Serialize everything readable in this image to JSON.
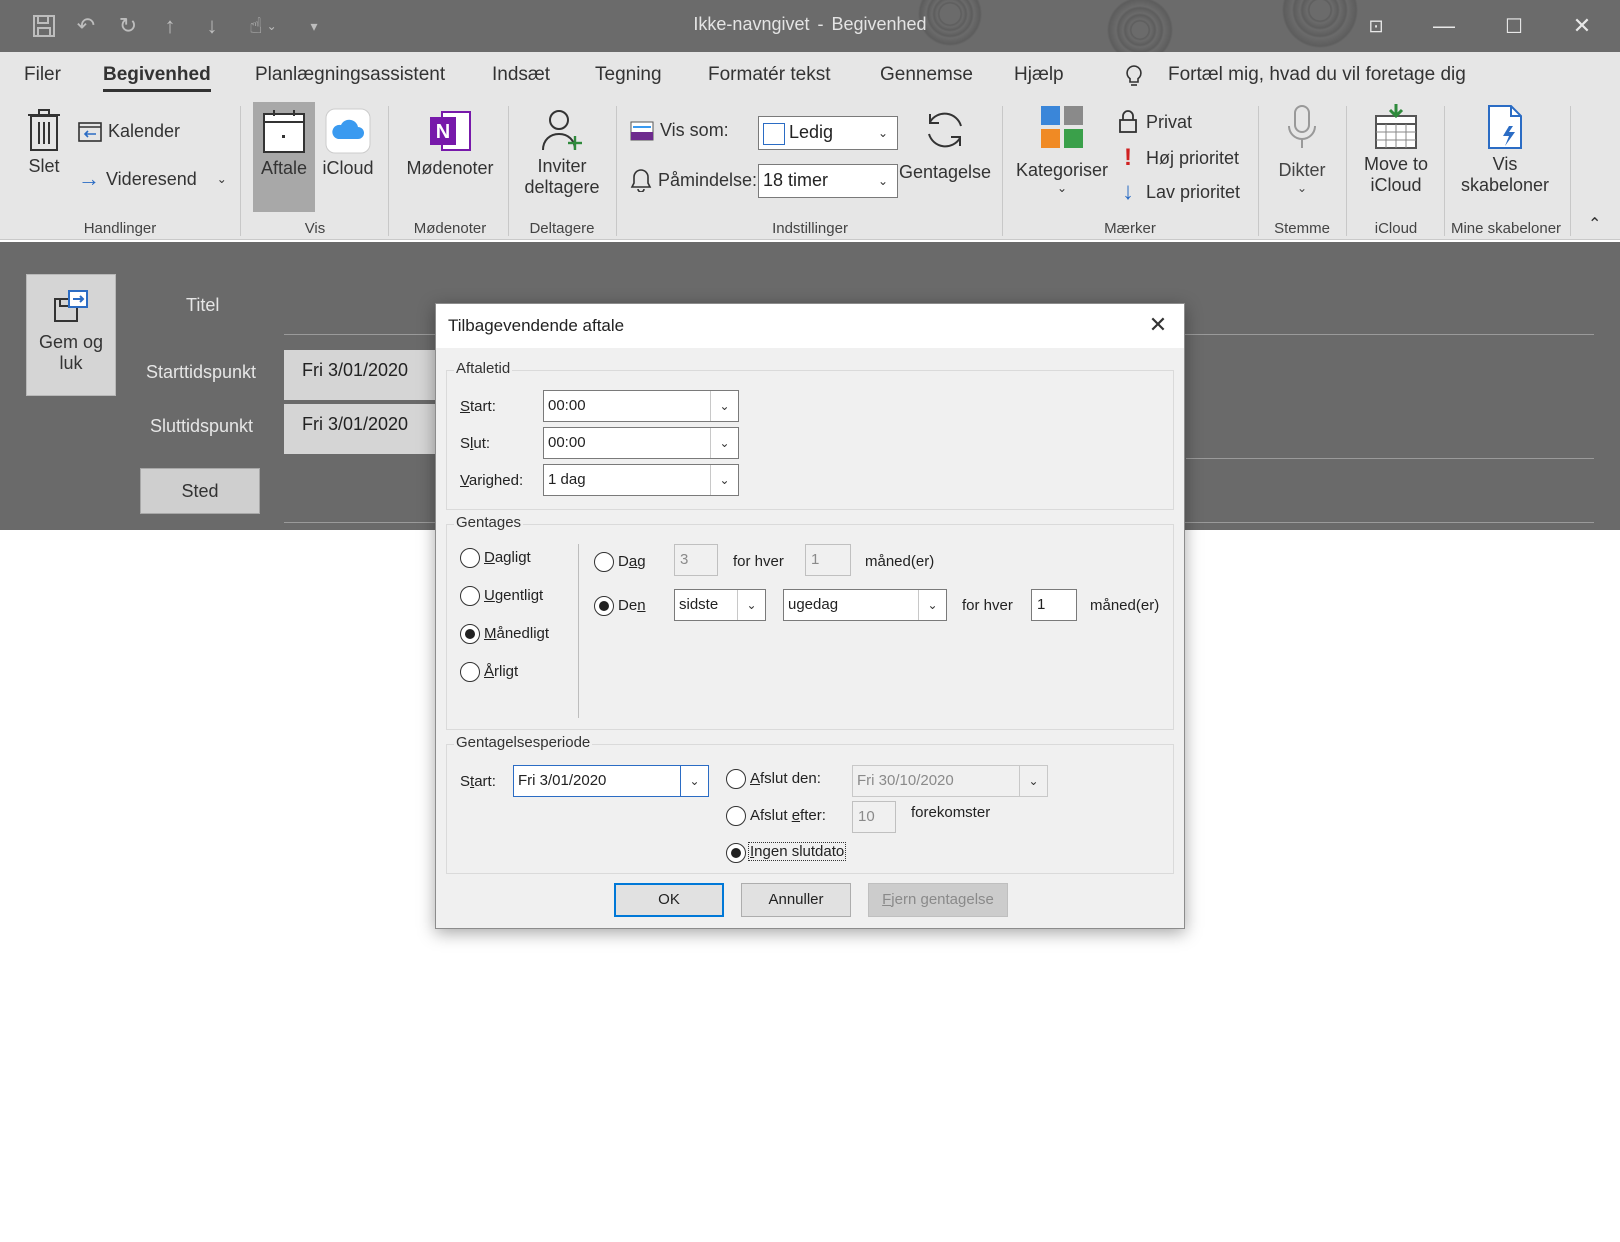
{
  "window": {
    "title": "Ikke-navngivet",
    "title_sep": "-",
    "subtitle": "Begivenhed"
  },
  "tabs": [
    "Filer",
    "Begivenhed",
    "Planlægningsassistent",
    "Indsæt",
    "Tegning",
    "Formatér tekst",
    "Gennemse",
    "Hjælp"
  ],
  "tell_me": "Fortæl mig, hvad du vil foretage dig",
  "ribbon": {
    "slet": "Slet",
    "kalender": "Kalender",
    "videresend": "Videresend",
    "handlinger": "Handlinger",
    "aftale": "Aftale",
    "icloud": "iCloud",
    "vis": "Vis",
    "modenoter_btn": "Mødenoter",
    "modenoter_grp": "Mødenoter",
    "inviter1": "Inviter",
    "inviter2": "deltagere",
    "deltagere": "Deltagere",
    "vis_som_label": "Vis som:",
    "vis_som_value": "Ledig",
    "paamindelse_label": "Påmindelse:",
    "paamindelse_value": "18 timer",
    "gentagelse": "Gentagelse",
    "indstillinger": "Indstillinger",
    "kategoriser": "Kategoriser",
    "privat": "Privat",
    "hoj": "Høj prioritet",
    "lav": "Lav prioritet",
    "maerker": "Mærker",
    "dikter": "Dikter",
    "stemme": "Stemme",
    "move1": "Move to",
    "move2": "iCloud",
    "icloud_grp": "iCloud",
    "vis_sk1": "Vis",
    "vis_sk2": "skabeloner",
    "mine_sk": "Mine skabeloner"
  },
  "form": {
    "gem1": "Gem og",
    "gem2": "luk",
    "titel": "Titel",
    "start_label": "Starttidspunkt",
    "start_value": "Fri 3/01/2020",
    "slut_label": "Sluttidspunkt",
    "slut_value": "Fri 3/01/2020",
    "sted": "Sted"
  },
  "dialog": {
    "title": "Tilbagevendende aftale",
    "aftaletid": "Aftaletid",
    "start_label": "Start:",
    "start_value": "00:00",
    "slut_label": "Slut:",
    "slut_value": "00:00",
    "varighed_label": "Varighed:",
    "varighed_value": "1 dag",
    "gentages": "Gentages",
    "dagligt": "Dagligt",
    "ugentligt": "Ugentligt",
    "maanedligt": "Månedligt",
    "aarligt": "Årligt",
    "dag": "Dag",
    "dag_value": "3",
    "for_hver": "for hver",
    "dag_interval": "1",
    "maaneder": "måned(er)",
    "den": "Den",
    "den_order": "sidste",
    "den_day": "ugedag",
    "den_interval": "1",
    "periode": "Gentagelsesperiode",
    "p_start_label": "Start:",
    "p_start_value": "Fri 3/01/2020",
    "afslut_den": "Afslut den:",
    "afslut_den_value": "Fri 30/10/2020",
    "afslut_efter": "Afslut efter:",
    "afslut_efter_value": "10",
    "forekomster": "forekomster",
    "ingen_slutdato": "Ingen slutdato",
    "ok": "OK",
    "annuller": "Annuller",
    "fjern": "Fjern gentagelse"
  }
}
